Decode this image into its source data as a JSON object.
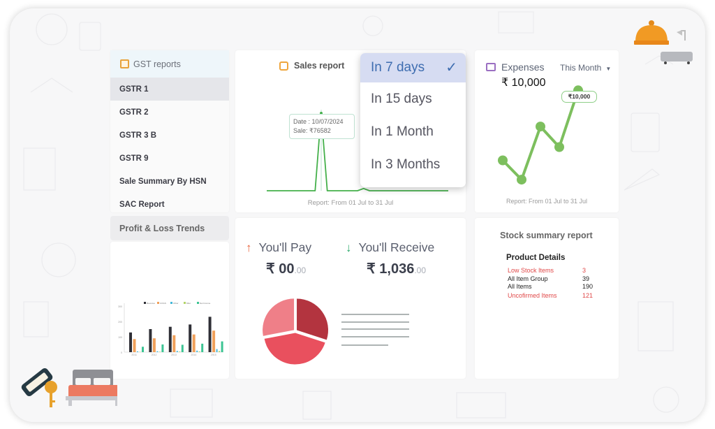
{
  "gst_reports": {
    "title": "GST reports",
    "icon": "report-icon",
    "items": [
      {
        "label": "GSTR 1",
        "active": true
      },
      {
        "label": "GSTR 2",
        "active": false
      },
      {
        "label": "GSTR 3 B",
        "active": false
      },
      {
        "label": "GSTR 9",
        "active": false
      },
      {
        "label": "Sale Summary By HSN",
        "active": false
      },
      {
        "label": "SAC Report",
        "active": false
      }
    ]
  },
  "profit_loss": {
    "tab_label": "Profit & Loss Trends",
    "chart_data": {
      "type": "bar",
      "title": "",
      "categories": [
        "2011",
        "2012",
        "2013",
        "2014",
        "2015"
      ],
      "series": [
        {
          "name": "Revenue",
          "color": "#2f2f36",
          "values": [
            128,
            150,
            165,
            180,
            230
          ]
        },
        {
          "name": "COGS",
          "color": "#f0a05a",
          "values": [
            85,
            90,
            110,
            115,
            140
          ]
        },
        {
          "name": "Other",
          "color": "#45b8d8",
          "values": [
            5,
            6,
            8,
            10,
            20
          ]
        },
        {
          "name": "Misc",
          "color": "#b3d46a",
          "values": [
            2,
            3,
            4,
            5,
            8
          ]
        },
        {
          "name": "Net Income",
          "color": "#3cc493",
          "values": [
            35,
            50,
            48,
            55,
            70
          ]
        }
      ],
      "ylim": [
        0,
        300
      ],
      "yticks": [
        0,
        100,
        200,
        300
      ],
      "legend": "top"
    }
  },
  "sales_report": {
    "title": "Sales report",
    "tooltip": {
      "date_line": "Date : 10/07/2024",
      "sale_line": "Sale: ₹76582"
    },
    "footer": "Report: From 01 Jul to 31 Jul",
    "line_color": "#44b04a",
    "chart_data": {
      "type": "line",
      "x": [
        1,
        2,
        3,
        4,
        5,
        6,
        7,
        8,
        9,
        10,
        11,
        12,
        13,
        14,
        15,
        16,
        17,
        18,
        19,
        20,
        21,
        22,
        23,
        24,
        25,
        26,
        27,
        28,
        29,
        30,
        31
      ],
      "values": [
        0,
        0,
        0,
        0,
        0,
        0,
        0,
        0,
        0,
        76582,
        0,
        0,
        0,
        0,
        0,
        0,
        2200,
        0,
        0,
        0,
        0,
        0,
        0,
        0,
        0,
        0,
        0,
        0,
        0,
        0,
        0
      ],
      "ylim": [
        0,
        80000
      ],
      "xlabel": "",
      "ylabel": ""
    }
  },
  "period_dropdown": {
    "options": [
      {
        "label": "In 7 days",
        "selected": true
      },
      {
        "label": "In 15 days",
        "selected": false
      },
      {
        "label": "In 1 Month",
        "selected": false
      },
      {
        "label": "In 3 Months",
        "selected": false
      }
    ],
    "check_icon": "✓"
  },
  "expenses": {
    "title": "Expenses",
    "period": "This Month",
    "amount": "₹ 10,000",
    "badge": "₹10,000",
    "footer": "Report: From 01 Jul to 31 Jul",
    "line_color": "#7dbf5e",
    "chart_data": {
      "type": "line",
      "x": [
        1,
        2,
        3,
        4,
        5
      ],
      "values": [
        4200,
        2600,
        7000,
        5300,
        10000
      ],
      "ylim": [
        0,
        11000
      ]
    }
  },
  "balances": {
    "pay": {
      "label": "You'll Pay",
      "amount": "₹ 00",
      "decimals": ".00",
      "arrow_color": "#e8643c"
    },
    "receive": {
      "label": "You'll Receive",
      "amount": "₹ 1,036",
      "decimals": ".00",
      "arrow_color": "#2aa86a"
    },
    "chart_data": {
      "type": "pie",
      "slices": [
        {
          "label": "",
          "value": 30,
          "color": "#b3343f"
        },
        {
          "label": "",
          "value": 42,
          "color": "#e9505e"
        },
        {
          "label": "",
          "value": 28,
          "color": "#ef7f88"
        }
      ],
      "legend": "right"
    }
  },
  "stock_summary": {
    "title": "Stock summary report",
    "subtitle": "Product Details",
    "rows": [
      {
        "label": "Low Stock Items",
        "value": "3",
        "alert": true
      },
      {
        "label": "All Item Group",
        "value": "39",
        "alert": false
      },
      {
        "label": "All Items",
        "value": "190",
        "alert": false
      },
      {
        "label": "Uncofirmed Items",
        "value": "121",
        "alert": true
      }
    ]
  },
  "decorations": {
    "top_right": [
      "service-bell-icon",
      "bathtub-icon"
    ],
    "bottom_left": [
      "room-key-icon",
      "bed-icon"
    ]
  }
}
